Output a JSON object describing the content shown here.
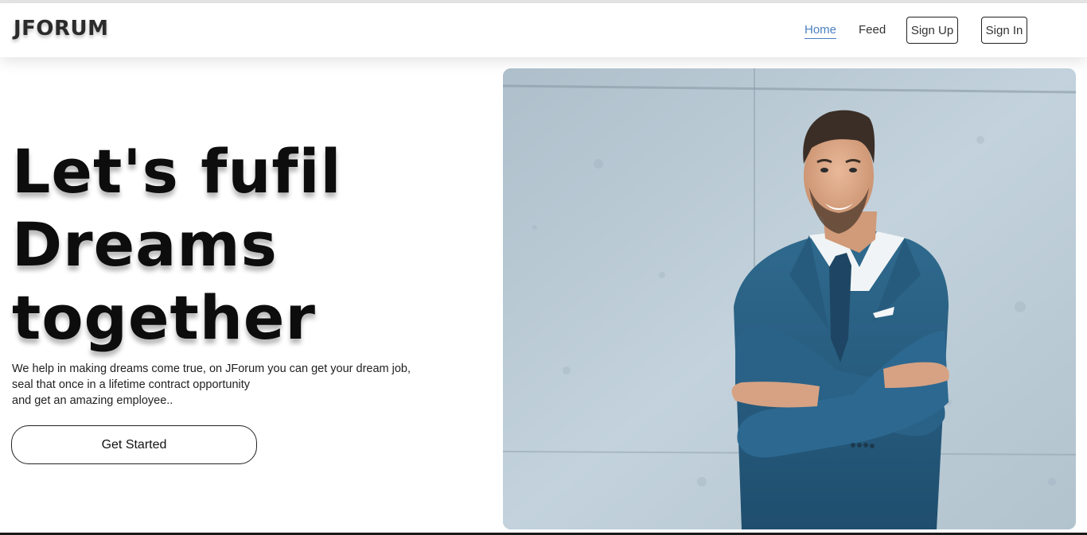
{
  "header": {
    "brand": "JFORUM",
    "nav": {
      "home": "Home",
      "feed": "Feed",
      "sign_up": "Sign Up",
      "sign_in": "Sign In"
    },
    "active_color": "#4a7fc1"
  },
  "hero": {
    "title_lines": [
      "Let's fufil",
      "Dreams",
      "together"
    ],
    "description_lines": [
      "We help in making dreams come true, on JForum you can get your dream job,",
      "seal that once in a lifetime contract opportunity",
      "and get an amazing employee.."
    ],
    "cta_label": "Get Started"
  },
  "image": {
    "subject": "smiling businessman in blue suit with crossed arms against concrete wall"
  }
}
